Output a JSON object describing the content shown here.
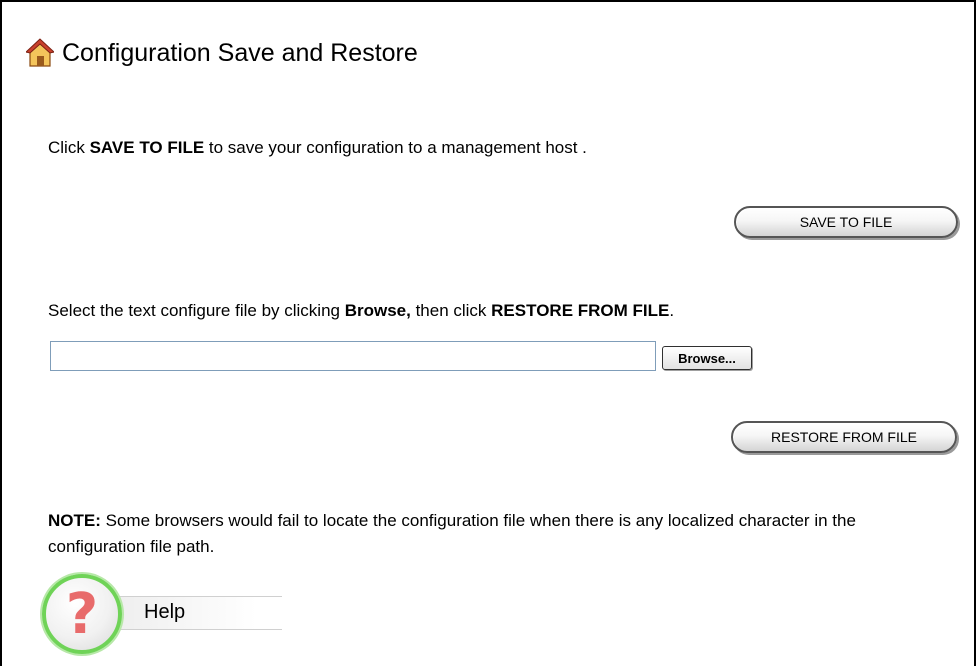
{
  "page": {
    "title": "Configuration Save and Restore"
  },
  "save_section": {
    "text_before": "Click ",
    "text_bold": "SAVE TO FILE",
    "text_after": " to save your configuration to a management host .",
    "button_label": "SAVE TO FILE"
  },
  "restore_section": {
    "text_before": "Select the text configure file by clicking ",
    "text_bold1": "Browse,",
    "text_middle": " then click ",
    "text_bold2": "RESTORE FROM FILE",
    "text_after": ".",
    "file_value": "",
    "browse_label": "Browse...",
    "button_label": "RESTORE FROM FILE"
  },
  "note": {
    "label": "NOTE:",
    "text": " Some browsers would fail to locate the configuration file when there is any localized character in the configuration file path."
  },
  "help": {
    "label": "Help",
    "icon_glyph": "?"
  },
  "colors": {
    "help_ring": "#6fd357",
    "help_mark": "#e86b6b",
    "input_border": "#7f9db9"
  }
}
